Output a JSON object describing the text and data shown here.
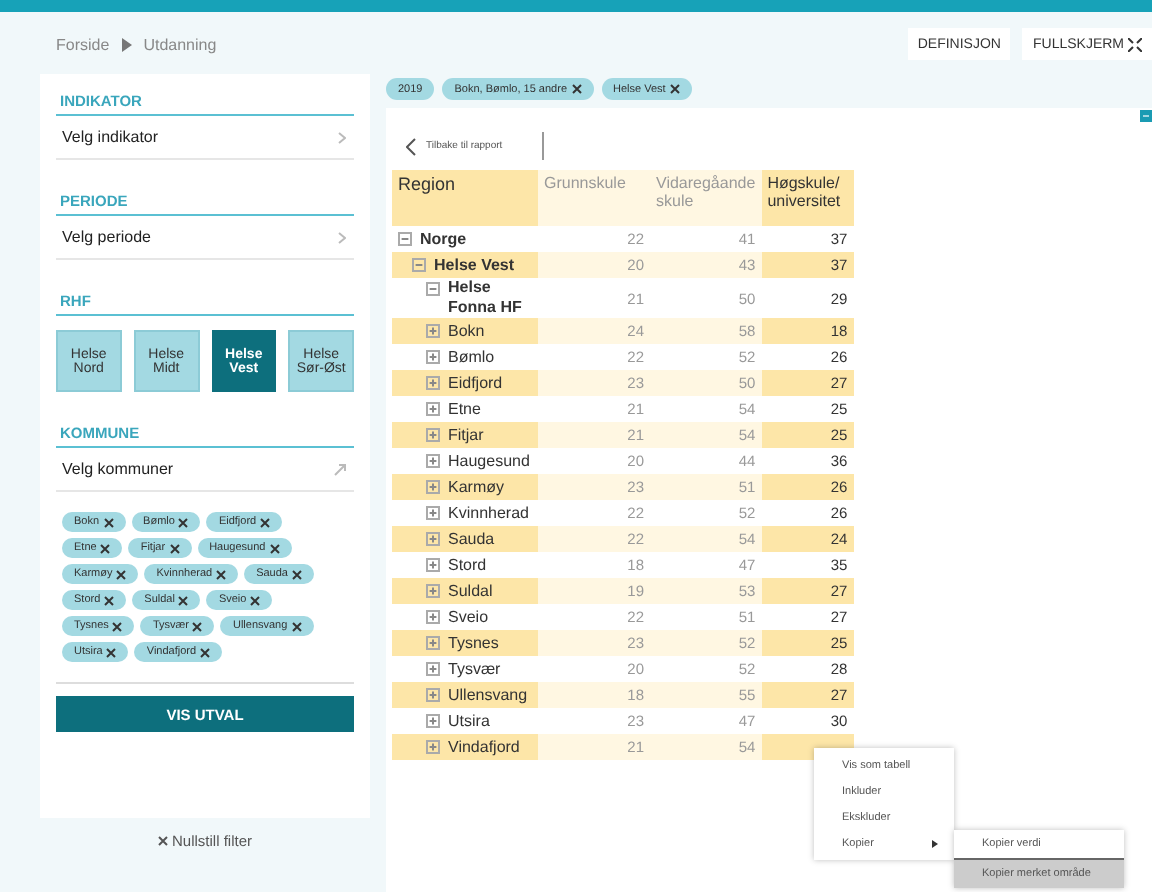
{
  "breadcrumb": [
    "Forside",
    "Utdanning"
  ],
  "header_buttons": [
    {
      "label": "DEFINISJON",
      "kind": "plain"
    },
    {
      "label": "FULLSKJERM",
      "kind": "fullscreen"
    }
  ],
  "sidebar": {
    "sections": [
      {
        "title": "INDIKATOR",
        "kind": "select",
        "placeholder": "Velg indikator"
      },
      {
        "title": "PERIODE",
        "kind": "select",
        "placeholder": "Velg periode"
      },
      {
        "title": "RHF",
        "kind": "choices",
        "options": [
          {
            "label": "Helse Nord",
            "selected": false
          },
          {
            "label": "Helse Midt",
            "selected": false
          },
          {
            "label": "Helse Vest",
            "selected": true
          },
          {
            "label": "Helse Sør-Øst",
            "selected": false
          }
        ]
      },
      {
        "title": "KOMMUNE",
        "kind": "multi",
        "placeholder": "Velg kommuner",
        "chips": [
          "Bokn",
          "Bømlo",
          "Eidfjord",
          "Etne",
          "Fitjar",
          "Haugesund",
          "Karmøy",
          "Kvinnherad",
          "Sauda",
          "Stord",
          "Suldal",
          "Sveio",
          "Tysnes",
          "Tysvær",
          "Ullensvang",
          "Utsira",
          "Vindafjord"
        ]
      }
    ],
    "apply_button": "VIS UTVAL",
    "reset_link": "Nullstill filter"
  },
  "filter_chips": [
    {
      "label": "2019",
      "removable": false
    },
    {
      "label": "Bokn, Bømlo, 15 andre",
      "removable": true
    },
    {
      "label": "Helse Vest",
      "removable": true
    }
  ],
  "back_link": "Tilbake til rapport",
  "table": {
    "columns": [
      {
        "label": "Region",
        "dim": false
      },
      {
        "label": "Grunnskule",
        "dim": true
      },
      {
        "label": "Vidaregåande skule",
        "dim": true
      },
      {
        "label": "Høgskule/ universitet",
        "dim": false
      }
    ],
    "rows": [
      {
        "region": "Norge",
        "values": [
          "22",
          "41",
          "37"
        ],
        "expanded": true,
        "children": [
          {
            "region": "Helse Vest",
            "values": [
              "20",
              "43",
              "37"
            ],
            "expanded": true,
            "children": [
              {
                "region": "Helse Fonna HF",
                "values": [
                  "21",
                  "50",
                  "29"
                ],
                "expanded": true,
                "children": [
                  {
                    "region": "Bokn",
                    "values": [
                      "24",
                      "58",
                      "18"
                    ],
                    "expanded": false
                  },
                  {
                    "region": "Bømlo",
                    "values": [
                      "22",
                      "52",
                      "26"
                    ],
                    "expanded": false
                  },
                  {
                    "region": "Eidfjord",
                    "values": [
                      "23",
                      "50",
                      "27"
                    ],
                    "expanded": false
                  },
                  {
                    "region": "Etne",
                    "values": [
                      "21",
                      "54",
                      "25"
                    ],
                    "expanded": false
                  },
                  {
                    "region": "Fitjar",
                    "values": [
                      "21",
                      "54",
                      "25"
                    ],
                    "expanded": false
                  },
                  {
                    "region": "Haugesund",
                    "values": [
                      "20",
                      "44",
                      "36"
                    ],
                    "expanded": false
                  },
                  {
                    "region": "Karmøy",
                    "values": [
                      "23",
                      "51",
                      "26"
                    ],
                    "expanded": false
                  },
                  {
                    "region": "Kvinnherad",
                    "values": [
                      "22",
                      "52",
                      "26"
                    ],
                    "expanded": false
                  },
                  {
                    "region": "Sauda",
                    "values": [
                      "22",
                      "54",
                      "24"
                    ],
                    "expanded": false
                  },
                  {
                    "region": "Stord",
                    "values": [
                      "18",
                      "47",
                      "35"
                    ],
                    "expanded": false
                  },
                  {
                    "region": "Suldal",
                    "values": [
                      "19",
                      "53",
                      "27"
                    ],
                    "expanded": false
                  },
                  {
                    "region": "Sveio",
                    "values": [
                      "22",
                      "51",
                      "27"
                    ],
                    "expanded": false
                  },
                  {
                    "region": "Tysnes",
                    "values": [
                      "23",
                      "52",
                      "25"
                    ],
                    "expanded": false
                  },
                  {
                    "region": "Tysvær",
                    "values": [
                      "20",
                      "52",
                      "28"
                    ],
                    "expanded": false
                  },
                  {
                    "region": "Ullensvang",
                    "values": [
                      "18",
                      "55",
                      "27"
                    ],
                    "expanded": false
                  },
                  {
                    "region": "Utsira",
                    "values": [
                      "23",
                      "47",
                      "30"
                    ],
                    "expanded": false
                  },
                  {
                    "region": "Vindafjord",
                    "values": [
                      "21",
                      "54"
                    ],
                    "expanded": false
                  }
                ]
              }
            ]
          }
        ]
      }
    ]
  },
  "context_menu": {
    "items": [
      {
        "label": "Vis som tabell",
        "submenu": false
      },
      {
        "label": "Inkluder",
        "submenu": false
      },
      {
        "label": "Ekskluder",
        "submenu": false
      },
      {
        "label": "Kopier",
        "submenu": true
      }
    ],
    "submenu": [
      {
        "label": "Kopier verdi",
        "selected": false
      },
      {
        "label": "Kopier merket område",
        "selected": true
      }
    ]
  }
}
